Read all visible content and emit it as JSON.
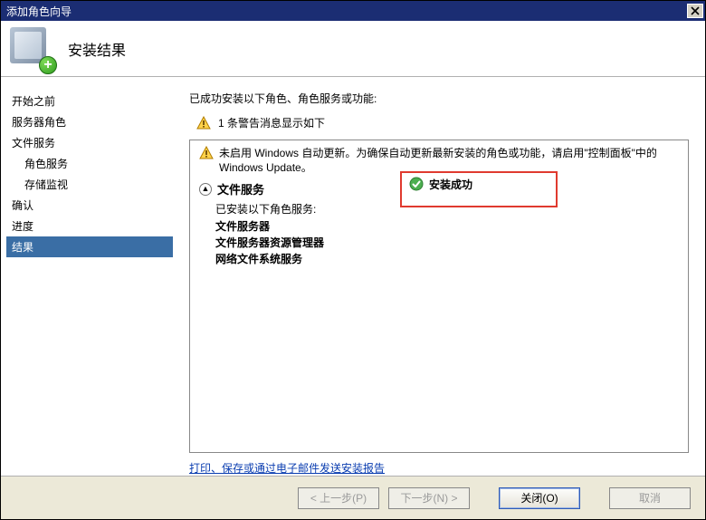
{
  "window": {
    "title": "添加角色向导"
  },
  "header": {
    "title": "安装结果"
  },
  "sidebar": {
    "items": [
      {
        "label": "开始之前"
      },
      {
        "label": "服务器角色"
      },
      {
        "label": "文件服务"
      },
      {
        "label": "角色服务"
      },
      {
        "label": "存储监视"
      },
      {
        "label": "确认"
      },
      {
        "label": "进度"
      },
      {
        "label": "结果"
      }
    ]
  },
  "content": {
    "summary": "已成功安装以下角色、角色服务或功能:",
    "warning_count_line": "1 条警告消息显示如下",
    "update_warning": "未启用 Windows 自动更新。为确保自动更新最新安装的角色或功能，请启用\"控制面板\"中的 Windows Update。",
    "service_name": "文件服务",
    "status_label": "安装成功",
    "installed_label": "已安装以下角色服务:",
    "installed_items": [
      "文件服务器",
      "文件服务器资源管理器",
      "网络文件系统服务"
    ],
    "link": "打印、保存或通过电子邮件发送安装报告"
  },
  "footer": {
    "prev": "< 上一步(P)",
    "next": "下一步(N) >",
    "close": "关闭(O)",
    "cancel": "取消"
  }
}
